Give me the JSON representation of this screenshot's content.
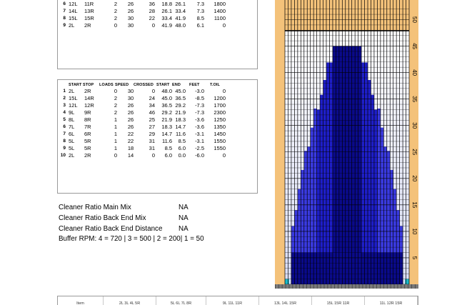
{
  "table1": {
    "rows": [
      {
        "n": "6",
        "start": "12L",
        "stop": "11R",
        "loads": "2",
        "speed": "26",
        "crossed": "36",
        "start_val": "18.8",
        "end_val": "26.1",
        "feet": "7.3",
        "tdil": "1800"
      },
      {
        "n": "7",
        "start": "14L",
        "stop": "13R",
        "loads": "2",
        "speed": "26",
        "crossed": "28",
        "start_val": "26.1",
        "end_val": "33.4",
        "feet": "7.3",
        "tdil": "1400"
      },
      {
        "n": "8",
        "start": "15L",
        "stop": "15R",
        "loads": "2",
        "speed": "30",
        "crossed": "22",
        "start_val": "33.4",
        "end_val": "41.9",
        "feet": "8.5",
        "tdil": "1100"
      },
      {
        "n": "9",
        "start": "2L",
        "stop": "2R",
        "loads": "0",
        "speed": "30",
        "crossed": "0",
        "start_val": "41.9",
        "end_val": "48.0",
        "feet": "6.1",
        "tdil": "0"
      }
    ]
  },
  "table2": {
    "headers": {
      "start": "START",
      "stop": "STOP",
      "loads": "LOADS",
      "speed": "SPEED",
      "crossed": "CROSSED",
      "start_val": "START",
      "end_val": "END",
      "feet": "FEET",
      "tdil": "T.OIL"
    },
    "rows": [
      {
        "n": "1",
        "start": "2L",
        "stop": "2R",
        "loads": "0",
        "speed": "30",
        "crossed": "0",
        "start_val": "48.0",
        "end_val": "45.0",
        "feet": "-3.0",
        "tdil": "0"
      },
      {
        "n": "2",
        "start": "15L",
        "stop": "14R",
        "loads": "2",
        "speed": "30",
        "crossed": "24",
        "start_val": "45.0",
        "end_val": "36.5",
        "feet": "-8.5",
        "tdil": "1200"
      },
      {
        "n": "3",
        "start": "12L",
        "stop": "12R",
        "loads": "2",
        "speed": "26",
        "crossed": "34",
        "start_val": "36.5",
        "end_val": "29.2",
        "feet": "-7.3",
        "tdil": "1700"
      },
      {
        "n": "4",
        "start": "9L",
        "stop": "9R",
        "loads": "2",
        "speed": "26",
        "crossed": "46",
        "start_val": "29.2",
        "end_val": "21.9",
        "feet": "-7.3",
        "tdil": "2300"
      },
      {
        "n": "5",
        "start": "8L",
        "stop": "8R",
        "loads": "1",
        "speed": "26",
        "crossed": "25",
        "start_val": "21.9",
        "end_val": "18.3",
        "feet": "-3.6",
        "tdil": "1250"
      },
      {
        "n": "6",
        "start": "7L",
        "stop": "7R",
        "loads": "1",
        "speed": "26",
        "crossed": "27",
        "start_val": "18.3",
        "end_val": "14.7",
        "feet": "-3.6",
        "tdil": "1350"
      },
      {
        "n": "7",
        "start": "6L",
        "stop": "6R",
        "loads": "1",
        "speed": "22",
        "crossed": "29",
        "start_val": "14.7",
        "end_val": "11.6",
        "feet": "-3.1",
        "tdil": "1450"
      },
      {
        "n": "8",
        "start": "5L",
        "stop": "5R",
        "loads": "1",
        "speed": "22",
        "crossed": "31",
        "start_val": "11.6",
        "end_val": "8.5",
        "feet": "-3.1",
        "tdil": "1550"
      },
      {
        "n": "9",
        "start": "5L",
        "stop": "5R",
        "loads": "1",
        "speed": "18",
        "crossed": "31",
        "start_val": "8.5",
        "end_val": "6.0",
        "feet": "-2.5",
        "tdil": "1550"
      },
      {
        "n": "10",
        "start": "2L",
        "stop": "2R",
        "loads": "0",
        "speed": "14",
        "crossed": "0",
        "start_val": "6.0",
        "end_val": "0.0",
        "feet": "-6.0",
        "tdil": "0"
      }
    ]
  },
  "info": {
    "main_mix_label": "Cleaner Ratio Main Mix",
    "main_mix_value": "NA",
    "back_end_mix_label": "Cleaner Ratio Back End Mix",
    "back_end_mix_value": "NA",
    "back_end_distance_label": "Cleaner Ratio Back End Distance",
    "back_end_distance_value": "NA",
    "buffer_rpm": "Buffer RPM: 4 = 720 | 3 = 500 | 2 = 200| 1 = 50"
  },
  "graph": {
    "y_ticks": [
      "5",
      "10",
      "15",
      "20",
      "25",
      "30",
      "35",
      "40",
      "45",
      "50"
    ],
    "colors": {
      "oil_deep": "#0a0a8a",
      "oil_mid": "#1e1ec8",
      "oil_light": "#3a3ae0",
      "lane_bg": "#eef0fb",
      "lane_top": "#ffffff",
      "gutter": "#f4c27a",
      "dry": "#f4c27a",
      "cap": "#1ab8c8",
      "scale": "#7a7a7a"
    }
  },
  "bottom_table": {
    "headers": [
      "Item",
      "2L 3L 4L 5R",
      "5L 6L 7L 8R",
      "9L 11L 11R",
      "13L 14L 15R",
      "15L 15R 11R",
      "11L 12R 15R"
    ]
  }
}
